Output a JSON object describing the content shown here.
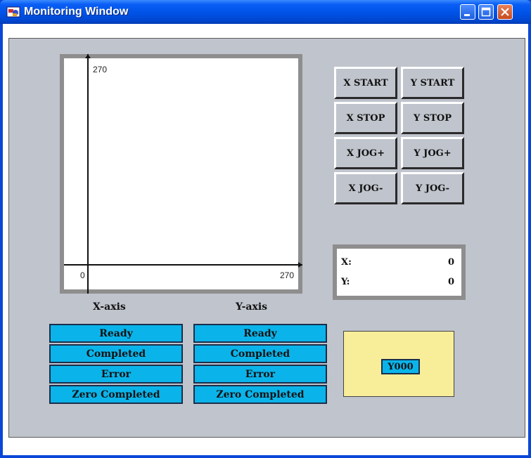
{
  "window": {
    "title": "Monitoring Window",
    "title_bar_color": "#0052e6"
  },
  "plot": {
    "y_max_label": "270",
    "x_max_label": "270",
    "origin_label": "0"
  },
  "buttons": [
    {
      "label": "X START"
    },
    {
      "label": "Y START"
    },
    {
      "label": "X STOP"
    },
    {
      "label": "Y STOP"
    },
    {
      "label": "X JOG+"
    },
    {
      "label": "Y JOG+"
    },
    {
      "label": "X JOG-"
    },
    {
      "label": "Y JOG-"
    }
  ],
  "position": {
    "x_label": "X:",
    "x_value": "0",
    "y_label": "Y:",
    "y_value": "0"
  },
  "status": {
    "x_axis_title": "X-axis",
    "y_axis_title": "Y-axis",
    "x_items": [
      "Ready",
      "Completed",
      "Error",
      "Zero Completed"
    ],
    "y_items": [
      "Ready",
      "Completed",
      "Error",
      "Zero Completed"
    ],
    "indicator_color": "#0ab4ea"
  },
  "output": {
    "label": "Y000",
    "box_color": "#f8ee9a"
  }
}
